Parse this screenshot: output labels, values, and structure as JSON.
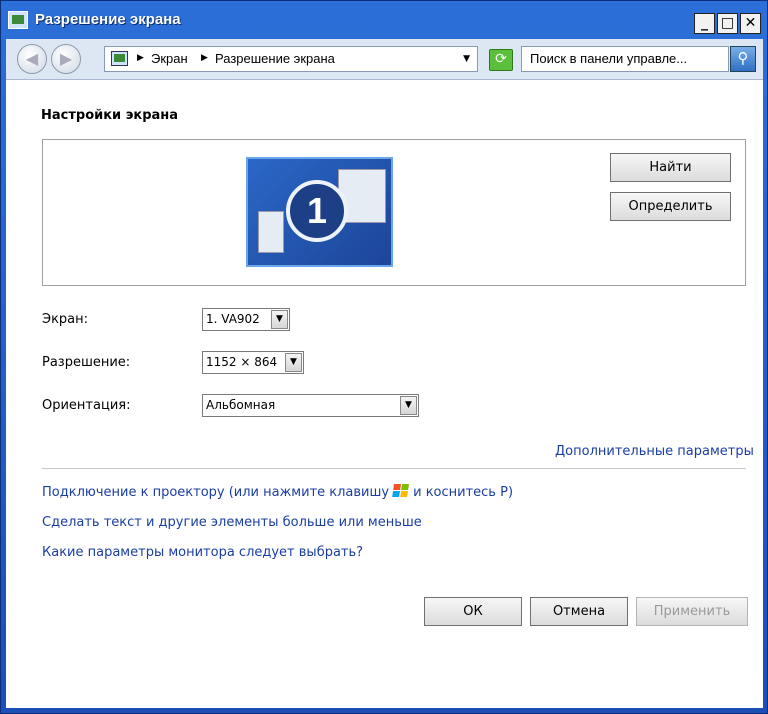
{
  "window": {
    "title": "Разрешение экрана",
    "minimize": "_",
    "maximize": "□",
    "close": "✕"
  },
  "toolbar": {
    "breadcrumbs": [
      "Экран",
      "Разрешение экрана"
    ],
    "search_placeholder": "Поиск в панели управле..."
  },
  "content": {
    "section_title": "Настройки экрана",
    "monitor_number": "1",
    "find_button": "Найти",
    "identify_button": "Определить",
    "screen_label": "Экран:",
    "screen_value": "1. VA902",
    "resolution_label": "Разрешение:",
    "resolution_value": "1152 × 864",
    "orientation_label": "Ориентация:",
    "orientation_value": "Альбомная",
    "advanced_link": "Дополнительные параметры",
    "projector_link_before": "Подключение к проектору (или нажмите клавишу",
    "projector_link_after": "и коснитесь P)",
    "text_size_link": "Сделать текст и другие элементы больше или меньше",
    "monitor_help_link": "Какие параметры монитора следует выбрать?",
    "ok_button": "ОК",
    "cancel_button": "Отмена",
    "apply_button": "Применить"
  }
}
